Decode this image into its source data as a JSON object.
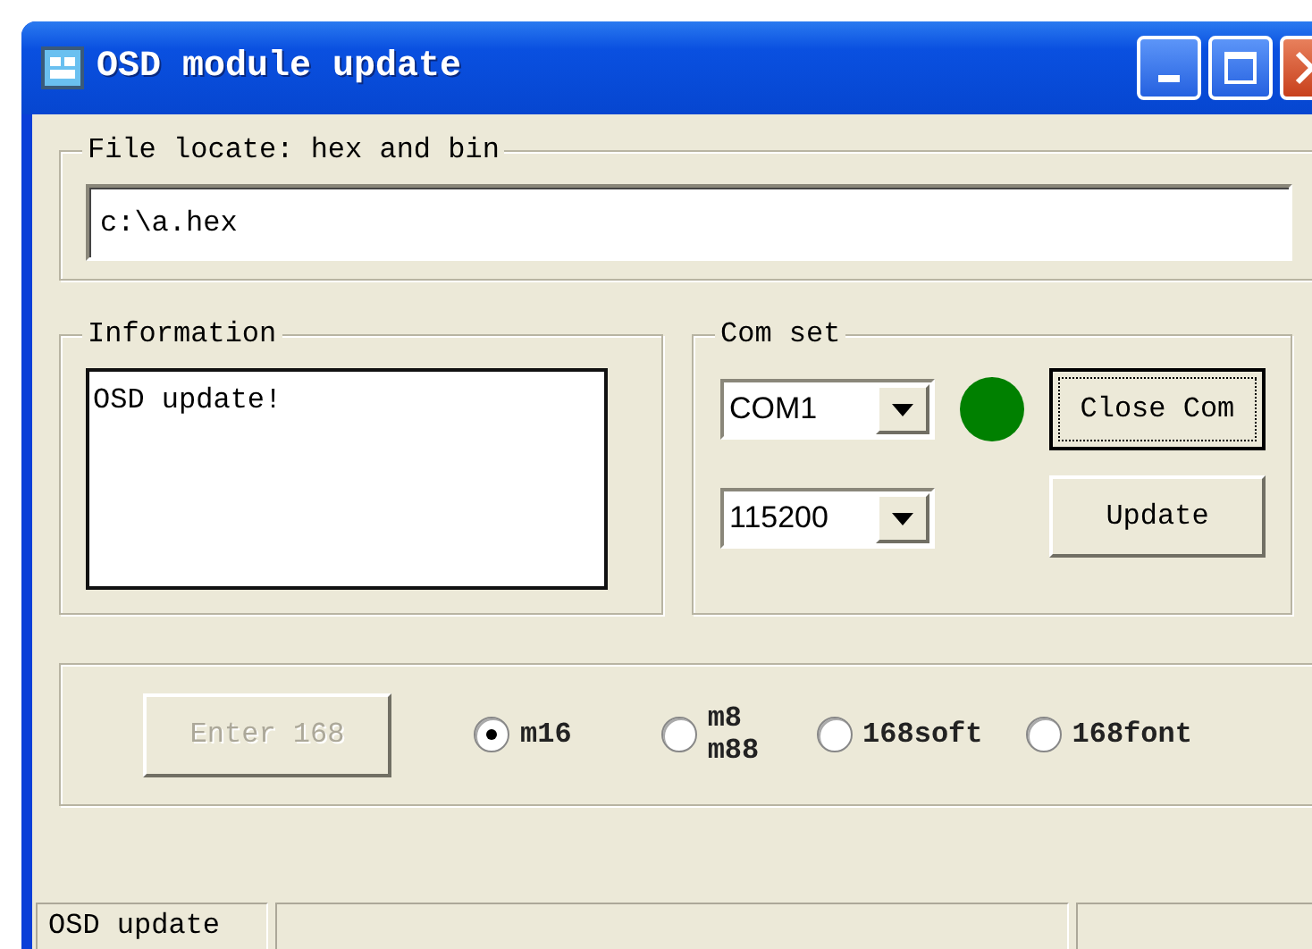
{
  "window": {
    "title": "OSD module update"
  },
  "file_locate": {
    "legend": "File locate: hex and bin",
    "value": "c:\\a.hex"
  },
  "information": {
    "legend": "Information",
    "text": "OSD update!"
  },
  "com_set": {
    "legend": "Com set",
    "port": "COM1",
    "baud": "115200",
    "connected": true,
    "buttons": [
      {
        "label": "Close Com",
        "focused": true
      },
      {
        "label": "Update",
        "focused": false
      }
    ]
  },
  "chip": {
    "button": {
      "label": "Enter 168",
      "disabled": true
    },
    "options": [
      {
        "label": "m16",
        "selected": true
      },
      {
        "label": "m8 m88",
        "selected": false
      },
      {
        "label": "168soft",
        "selected": false
      },
      {
        "label": "168font",
        "selected": false
      }
    ]
  },
  "status_bar": [
    "OSD update"
  ]
}
